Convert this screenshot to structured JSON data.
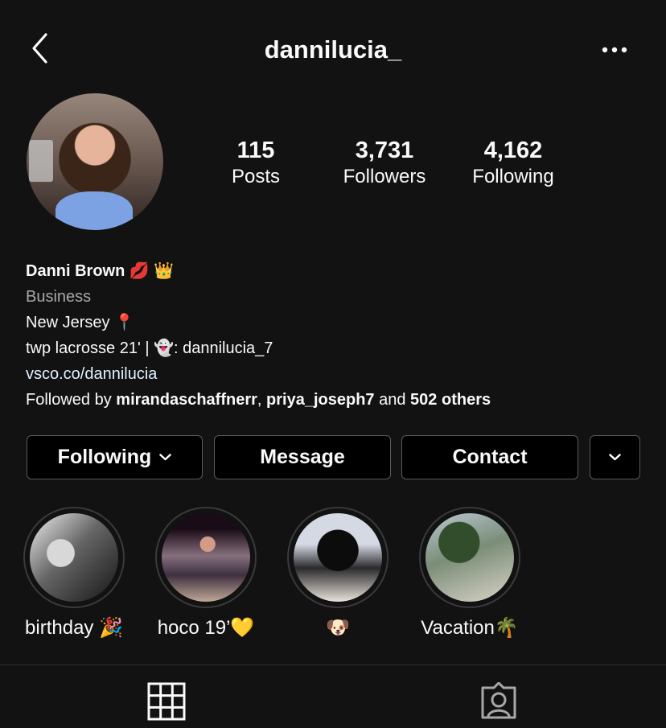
{
  "header": {
    "username": "dannilucia_"
  },
  "stats": [
    {
      "value": "115",
      "label": "Posts"
    },
    {
      "value": "3,731",
      "label": "Followers"
    },
    {
      "value": "4,162",
      "label": "Following"
    }
  ],
  "bio": {
    "name": "Danni Brown 💋 👑",
    "category": "Business",
    "location": "New Jersey 📍",
    "line2": "twp lacrosse 21' | 👻: dannilucia_7",
    "link": "vsco.co/dannilucia",
    "followed_prefix": "Followed by",
    "followers": [
      "mirandaschaffnerr",
      "priya_joseph7"
    ],
    "followed_and": "and",
    "followed_others": "502 others"
  },
  "buttons": {
    "following": "Following",
    "message": "Message",
    "contact": "Contact"
  },
  "highlights": [
    {
      "label": "birthday 🎉"
    },
    {
      "label": "hoco 19’💛"
    },
    {
      "label": "🐶"
    },
    {
      "label": "Vacation🌴"
    }
  ],
  "icons": {
    "back": "chevron-left-icon",
    "more": "more-horizontal-icon",
    "dropdown": "chevron-down-icon",
    "grid": "grid-icon",
    "tagged": "tagged-person-icon"
  },
  "colors": {
    "background": "#121212",
    "button_background": "#000000",
    "text": "#fafafa",
    "muted_text": "#a8a8a8",
    "link": "#e0f1ff"
  }
}
